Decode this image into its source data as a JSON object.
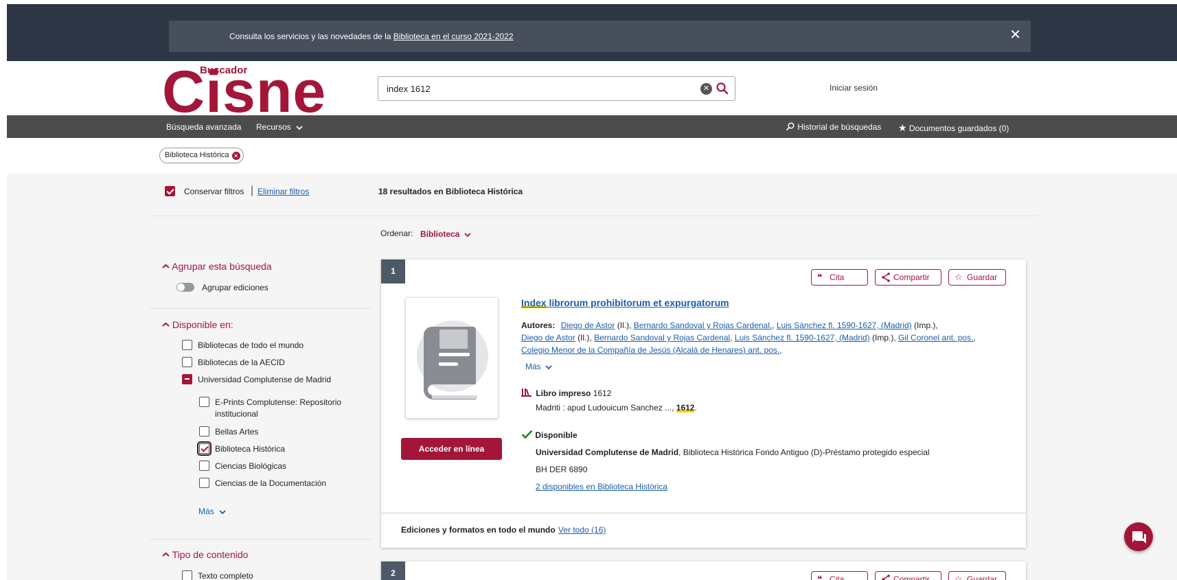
{
  "banner": {
    "text_prefix": "Consulta los servicios y las novedades de la ",
    "link": "Biblioteca en el curso 2021-2022",
    "close": "✕"
  },
  "logo": {
    "small": "Buscador",
    "big": "Cisne"
  },
  "search": {
    "value": "index 1612",
    "placeholder": ""
  },
  "header": {
    "login": "Iniciar sesión"
  },
  "nav": {
    "advanced": "Búsqueda avanzada",
    "resources": "Recursos",
    "history": "Historial de búsquedas",
    "saved": "Documentos guardados (0)"
  },
  "chip": {
    "label": "Biblioteca Histórica"
  },
  "filters_bar": {
    "keep_filters": "Conservar filtros",
    "remove_filters": "Eliminar filtros",
    "results_count": "18 resultados en Biblioteca Histórica"
  },
  "sort": {
    "label": "Ordenar:",
    "value": "Biblioteca"
  },
  "sidebar": {
    "group_title": "Agrupar esta búsqueda",
    "group_toggle": "Agrupar ediciones",
    "available_title": "Disponible en:",
    "available_items": [
      "Bibliotecas de todo el mundo",
      "Bibliotecas de la AECID",
      "Universidad Complutense de Madrid"
    ],
    "sub_items": [
      "E-Prints Complutense: Repositorio",
      "institucional",
      "Bellas Artes",
      "Biblioteca Histórica",
      "Ciencias Biológicas",
      "Ciencias de la Documentación"
    ],
    "more": "Más",
    "content_title": "Tipo de contenido",
    "content_items": [
      "Texto completo"
    ]
  },
  "result1": {
    "number": "1",
    "cite": "Cita",
    "share": "Compartir",
    "save": "Guardar",
    "title_hl": "Index",
    "title_rest": " librorum prohibitorum et expurgatorum",
    "authors_label": "Autores:",
    "author_1": "Diego de Astor",
    "role_il": "(Il.),",
    "author_2": "Bernardo Sandoval y Rojas Cardenal.",
    "author_3": "Luis Sánchez fl. 1590-1627, (Madrid)",
    "role_imp": "(Imp.),",
    "author_4": "Diego de Astor",
    "author_5": "Bernardo Sandoval y Rojas Cardenal",
    "author_6": "Luis Sánchez fl. 1590-1627, (Madrid)",
    "author_7": "Gil Coronel ant. pos.",
    "author_8": "Colegio Menor de la Compañía de Jesús (Alcalá de Henares) ant. pos.",
    "more": "Más",
    "format": "Libro impreso",
    "year": "1612",
    "imprint_prefix": "Madriti : apud Ludouicum Sanchez ..., ",
    "imprint_year": "1612",
    "access": "Acceder en línea",
    "status": "Disponible",
    "holder_bold": "Universidad Complutense de Madrid",
    "holder_rest": ", Biblioteca Histórica Fondo Antiguo (D)-Préstamo protegido especial",
    "callnumber": "BH DER 6890",
    "copies_link": "2 disponibles en Biblioteca Histórica",
    "editions_label": "Ediciones y formatos en todo el mundo",
    "see_all": "Ver todo (16)"
  },
  "result2": {
    "number": "2",
    "cite": "Cita",
    "share": "Compartir",
    "save": "Guardar"
  },
  "colors": {
    "brand": "#a3163a",
    "dark_band": "#2d3645",
    "nav_band": "#4c4c4c",
    "link": "#1a5ea8"
  },
  "icons": [
    "close-icon",
    "clear-search-icon",
    "search-icon",
    "chevron-down-icon",
    "history-search-icon",
    "star-icon",
    "quote-icon",
    "share-icon",
    "book-cover-icon",
    "printed-book-icon",
    "check-icon",
    "chat-icon"
  ]
}
